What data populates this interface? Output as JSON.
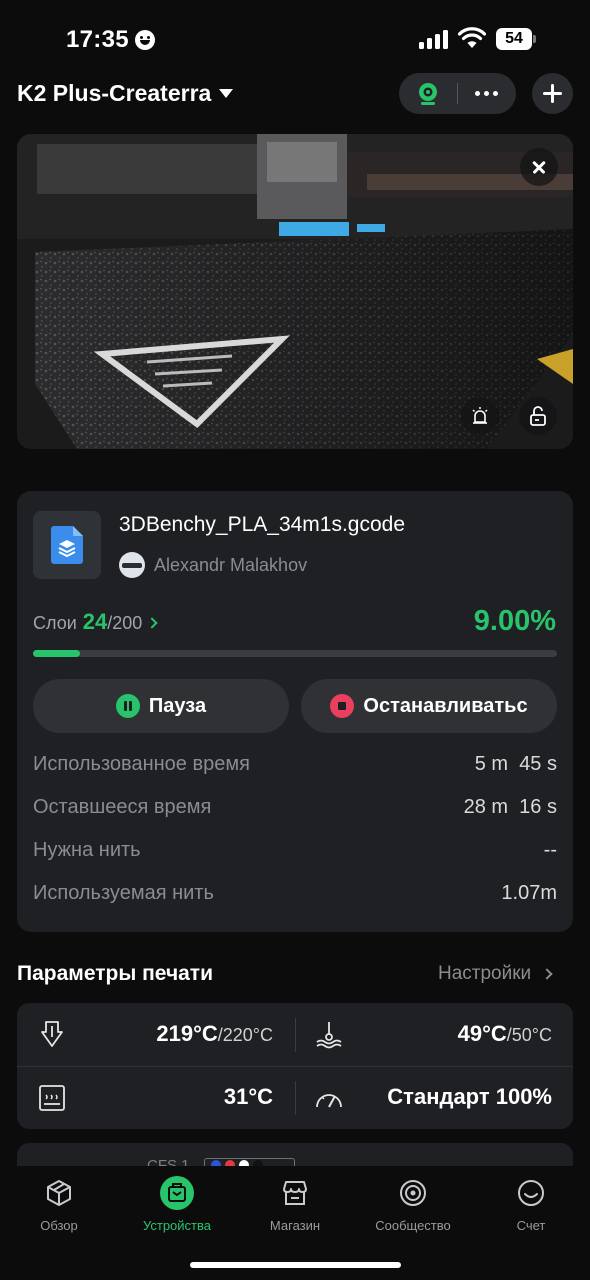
{
  "status_bar": {
    "time": "17:35",
    "battery": "54"
  },
  "header": {
    "device_name": "K2 Plus-Createrra"
  },
  "job": {
    "file_name": "3DBenchy_PLA_34m1s.gcode",
    "owner": "Alexandr Malakhov",
    "layers_label": "Слои",
    "layer_current": "24",
    "layer_total": "/200",
    "percent": "9.00%",
    "progress_fraction": 0.09,
    "pause_label": "Пауза",
    "stop_label": "Останавливатьс",
    "stats": [
      {
        "label": "Использованное время",
        "value": "5 m  45 s"
      },
      {
        "label": "Оставшееся время",
        "value": "28 m  16 s"
      },
      {
        "label": "Нужна нить",
        "value": "--"
      },
      {
        "label": "Используемая нить",
        "value": "1.07m"
      }
    ]
  },
  "print_params": {
    "title": "Параметры печати",
    "settings_link": "Настройки",
    "nozzle_temp": "219°C",
    "nozzle_target": "/220°C",
    "bed_temp": "49°C",
    "bed_target": "/50°C",
    "chamber_temp": "31°C",
    "speed": "Стандарт 100%"
  },
  "next_card_peek": "CFS 1",
  "tabs": [
    {
      "label": "Обзор",
      "icon": "cube-icon"
    },
    {
      "label": "Устройства",
      "icon": "printer-icon",
      "active": true
    },
    {
      "label": "Магазин",
      "icon": "store-icon"
    },
    {
      "label": "Сообщество",
      "icon": "community-icon"
    },
    {
      "label": "Счет",
      "icon": "account-icon"
    }
  ],
  "colors": {
    "accent": "#27c46b",
    "stop": "#e8405e",
    "card": "#1f2023",
    "background": "#0c0c0d"
  }
}
